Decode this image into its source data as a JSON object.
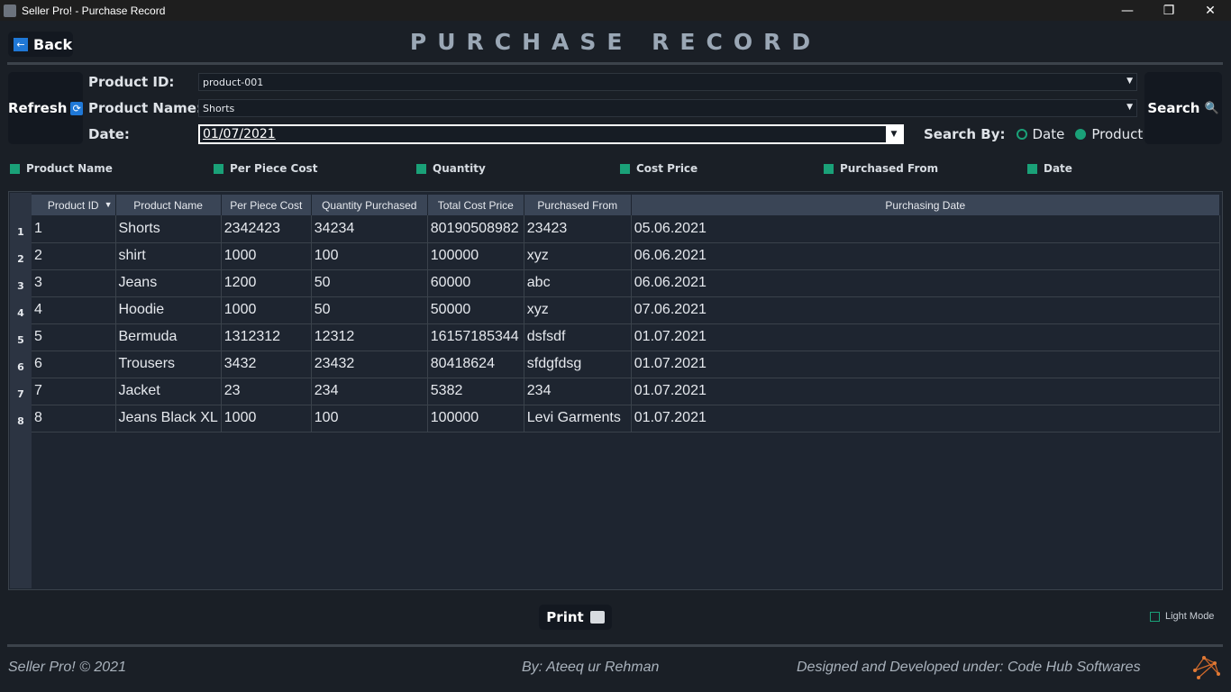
{
  "window": {
    "title": "Seller Pro! - Purchase Record",
    "minimize": "—",
    "restore": "❐",
    "close": "✕"
  },
  "header": {
    "back_label": "Back",
    "title": "PURCHASE RECORD"
  },
  "filters": {
    "refresh_label": "Refresh",
    "search_label": "Search",
    "product_id_label": "Product ID:",
    "product_id_value": "product-001",
    "product_name_label": "Product Name:",
    "product_name_value": "Shorts",
    "date_label": "Date:",
    "date_value": "01/07/2021",
    "search_by_label": "Search By:",
    "search_by_options": [
      "Date",
      "Product"
    ],
    "search_by_selected": "Product"
  },
  "column_toggles": [
    "Product Name",
    "Per Piece Cost",
    "Quantity",
    "Cost Price",
    "Purchased From",
    "Date"
  ],
  "table": {
    "columns": [
      "Product ID",
      "Product Name",
      "Per Piece Cost",
      "Quantity Purchased",
      "Total Cost Price",
      "Purchased From",
      "Purchasing Date"
    ],
    "rows": [
      [
        "1",
        "Shorts",
        "2342423",
        "34234",
        "80190508982",
        "23423",
        "05.06.2021"
      ],
      [
        "2",
        "shirt",
        "1000",
        "100",
        "100000",
        "xyz",
        "06.06.2021"
      ],
      [
        "3",
        "Jeans",
        "1200",
        "50",
        "60000",
        "abc",
        "06.06.2021"
      ],
      [
        "4",
        "Hoodie",
        "1000",
        "50",
        "50000",
        "xyz",
        "07.06.2021"
      ],
      [
        "5",
        "Bermuda",
        "1312312",
        "12312",
        "16157185344",
        "dsfsdf",
        "01.07.2021"
      ],
      [
        "6",
        "Trousers",
        "3432",
        "23432",
        "80418624",
        "sfdgfdsg",
        "01.07.2021"
      ],
      [
        "7",
        "Jacket",
        "23",
        "234",
        "5382",
        "234",
        "01.07.2021"
      ],
      [
        "8",
        "Jeans Black XL",
        "1000",
        "100",
        "100000",
        "Levi Garments",
        "01.07.2021"
      ]
    ],
    "row_numbers": [
      "1",
      "2",
      "3",
      "4",
      "5",
      "6",
      "7",
      "8"
    ]
  },
  "actions": {
    "print_label": "Print",
    "light_mode_label": "Light Mode"
  },
  "footer": {
    "left": "Seller Pro! © 2021",
    "middle": "By: Ateeq ur Rehman",
    "right": "Designed and Developed under: Code Hub Softwares",
    "logo_text": "Code Hub"
  },
  "colors": {
    "accent": "#1aa178",
    "icon_blue": "#1f78d7",
    "background": "#1a1f26",
    "header_cell": "#3a4556"
  },
  "icons": {
    "back": "arrow-left-icon",
    "refresh": "refresh-icon",
    "search": "magnifier-icon",
    "print": "printer-icon"
  }
}
